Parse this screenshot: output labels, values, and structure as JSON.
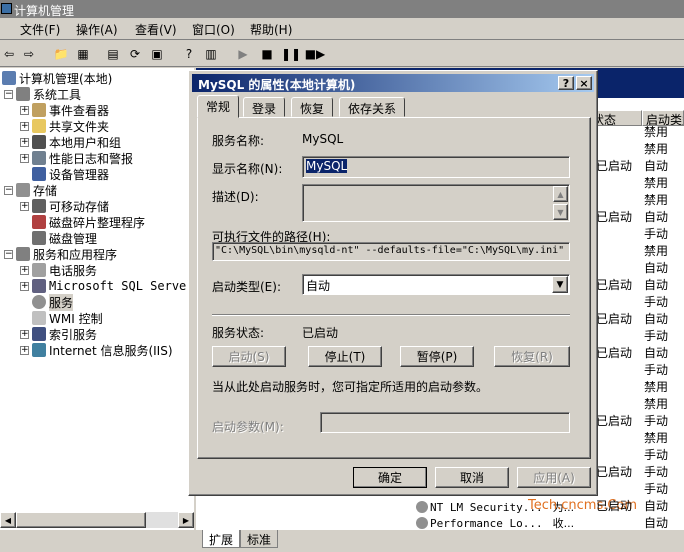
{
  "main_window": {
    "title": "计算机管理",
    "menu": [
      "文件(F)",
      "操作(A)",
      "查看(V)",
      "窗口(O)",
      "帮助(H)"
    ]
  },
  "tree": {
    "root": "计算机管理(本地)",
    "items": [
      {
        "label": "系统工具"
      },
      {
        "label": "事件查看器"
      },
      {
        "label": "共享文件夹"
      },
      {
        "label": "本地用户和组"
      },
      {
        "label": "性能日志和警报"
      },
      {
        "label": "设备管理器"
      },
      {
        "label": "存储"
      },
      {
        "label": "可移动存储"
      },
      {
        "label": "磁盘碎片整理程序"
      },
      {
        "label": "磁盘管理"
      },
      {
        "label": "服务和应用程序"
      },
      {
        "label": "电话服务"
      },
      {
        "label": "Microsoft SQL Servers"
      },
      {
        "label": "服务"
      },
      {
        "label": "WMI 控制"
      },
      {
        "label": "索引服务"
      },
      {
        "label": "Internet 信息服务(IIS)"
      }
    ]
  },
  "service_list": {
    "col_status": "状态",
    "col_startup": "启动类型",
    "rows": [
      {
        "status": "",
        "startup": "禁用"
      },
      {
        "status": "",
        "startup": "禁用"
      },
      {
        "status": "已启动",
        "startup": "自动"
      },
      {
        "status": "",
        "startup": "禁用"
      },
      {
        "status": "",
        "startup": "禁用"
      },
      {
        "status": "已启动",
        "startup": "自动"
      },
      {
        "status": "",
        "startup": "手动"
      },
      {
        "status": "",
        "startup": "禁用"
      },
      {
        "status": "",
        "startup": "自动"
      },
      {
        "status": "已启动",
        "startup": "自动"
      },
      {
        "status": "",
        "startup": "手动"
      },
      {
        "status": "已启动",
        "startup": "自动"
      },
      {
        "status": "",
        "startup": "手动"
      },
      {
        "status": "已启动",
        "startup": "自动"
      },
      {
        "status": "",
        "startup": "手动"
      },
      {
        "status": "",
        "startup": "禁用"
      },
      {
        "status": "",
        "startup": "禁用"
      },
      {
        "status": "已启动",
        "startup": "手动"
      },
      {
        "status": "",
        "startup": "禁用"
      },
      {
        "status": "",
        "startup": "手动"
      },
      {
        "status": "已启动",
        "startup": "手动"
      },
      {
        "status": "",
        "startup": "手动"
      },
      {
        "status": "已启动",
        "startup": "自动"
      },
      {
        "status": "",
        "startup": "自动"
      }
    ],
    "bottom_rows": [
      {
        "name": "NT LM Security...",
        "desc": "为..."
      },
      {
        "name": "Performance Lo...",
        "desc": "收..."
      }
    ],
    "watermark": "Tech.cncms.Com"
  },
  "bottom_tabs": [
    "扩展",
    "标准"
  ],
  "dialog": {
    "title": "MySQL 的属性(本地计算机)",
    "help_btn": "?",
    "close_btn": "×",
    "tabs": [
      "常规",
      "登录",
      "恢复",
      "依存关系"
    ],
    "service_name_label": "服务名称:",
    "service_name": "MySQL",
    "display_name_label": "显示名称(N):",
    "display_name": "MySQL",
    "description_label": "描述(D):",
    "exe_path_label": "可执行文件的路径(H):",
    "exe_path": "\"C:\\MySQL\\bin\\mysqld-nt\" --defaults-file=\"C:\\MySQL\\my.ini\" M",
    "startup_type_label": "启动类型(E):",
    "startup_type": "自动",
    "status_label": "服务状态:",
    "status": "已启动",
    "btn_start": "启动(S)",
    "btn_stop": "停止(T)",
    "btn_pause": "暂停(P)",
    "btn_resume": "恢复(R)",
    "hint": "当从此处启动服务时，您可指定所适用的启动参数。",
    "params_label": "启动参数(M):",
    "ok": "确定",
    "cancel": "取消",
    "apply": "应用(A)"
  }
}
